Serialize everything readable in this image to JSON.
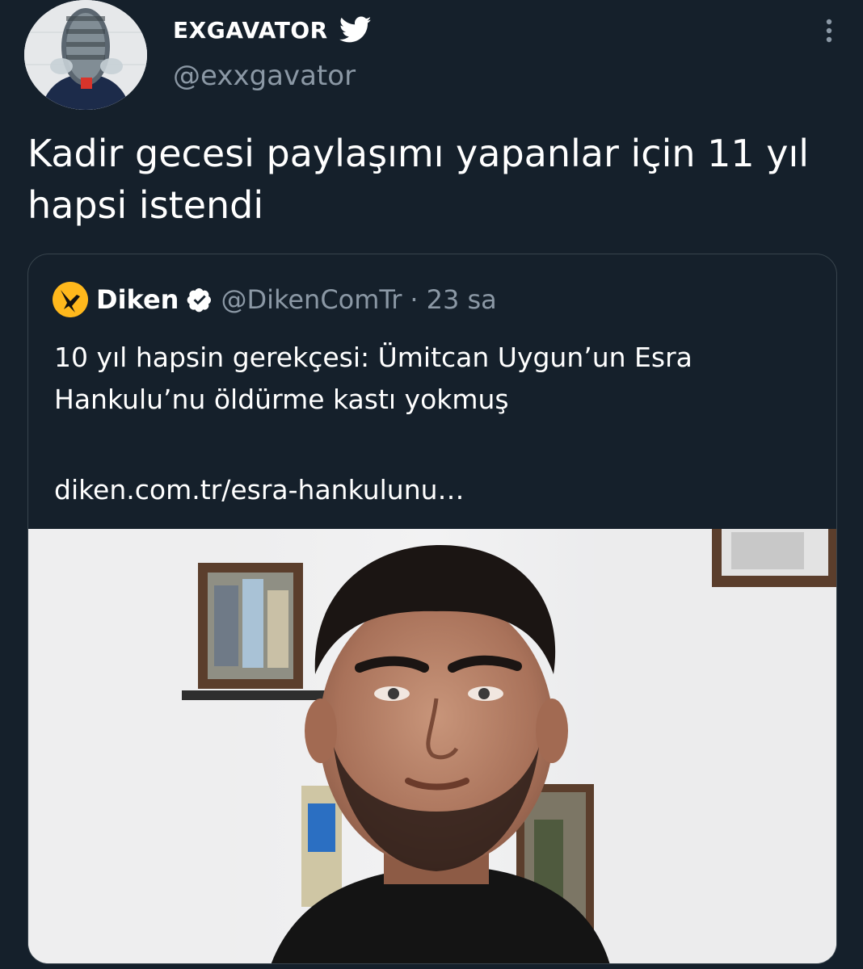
{
  "tweet": {
    "author": {
      "display_name": "EXGAVATOR",
      "handle": "@exxgavator",
      "avatar_icon": "avatar",
      "verified_badge_icon": "twitter-bird-icon"
    },
    "more_icon": "more-vertical-icon",
    "text": "Kadir gecesi paylaşımı yapanlar için 11 yıl hapsi istendi",
    "quoted": {
      "author": {
        "display_name": "Diken",
        "handle": "@DikenComTr",
        "separator": "·",
        "time": "23 sa",
        "verified_icon": "verified-badge-icon",
        "avatar_icon": "diken-logo-icon"
      },
      "text": "10 yıl hapsin gerekçesi: Ümitcan Uygun’un Esra Hankulu’nu öldürme kastı yokmuş",
      "link": "diken.com.tr/esra-hankulunu…",
      "image": "news-photo"
    }
  },
  "colors": {
    "background": "#15202b",
    "text_primary": "#ffffff",
    "text_secondary": "#8b98a5",
    "border": "#38444d",
    "accent": "#1d9bf0",
    "diken_brand": "#ffb81c"
  }
}
